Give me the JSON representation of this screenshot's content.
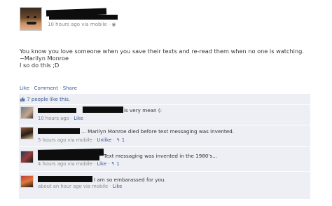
{
  "post": {
    "meta_time": "10 hours ago via mobile",
    "meta_sep": "·",
    "text_line1": "You know you love someone when you save their texts and re-read them when no one is watching.",
    "text_line2": "~Marilyn Monroe",
    "text_line3": "I so do this ;D"
  },
  "actions": {
    "like": "Like",
    "comment": "Comment",
    "share": "Share",
    "sep": "·"
  },
  "likes_line": "7 people like this.",
  "comments": [
    {
      "text": "is very mean (:",
      "time": "10 hours ago",
      "like": "Like"
    },
    {
      "text": "... Marilyn Monroe died before text messaging was invented.",
      "time": "5 hours ago via mobile",
      "like": "Unlike",
      "like_count": "1"
    },
    {
      "text": "Text messaging was invented in the 1980's...",
      "time": "4 hours ago via mobile",
      "like": "Like",
      "like_count": "1"
    },
    {
      "text": "I am so embarassed for you.",
      "time": "about an hour ago via mobile",
      "like": "Like"
    }
  ],
  "colors": {
    "link": "#3b5998",
    "ufi_background": "#edeff4",
    "meta_gray": "#8a8a8a",
    "redaction": "#0d0d0d"
  }
}
